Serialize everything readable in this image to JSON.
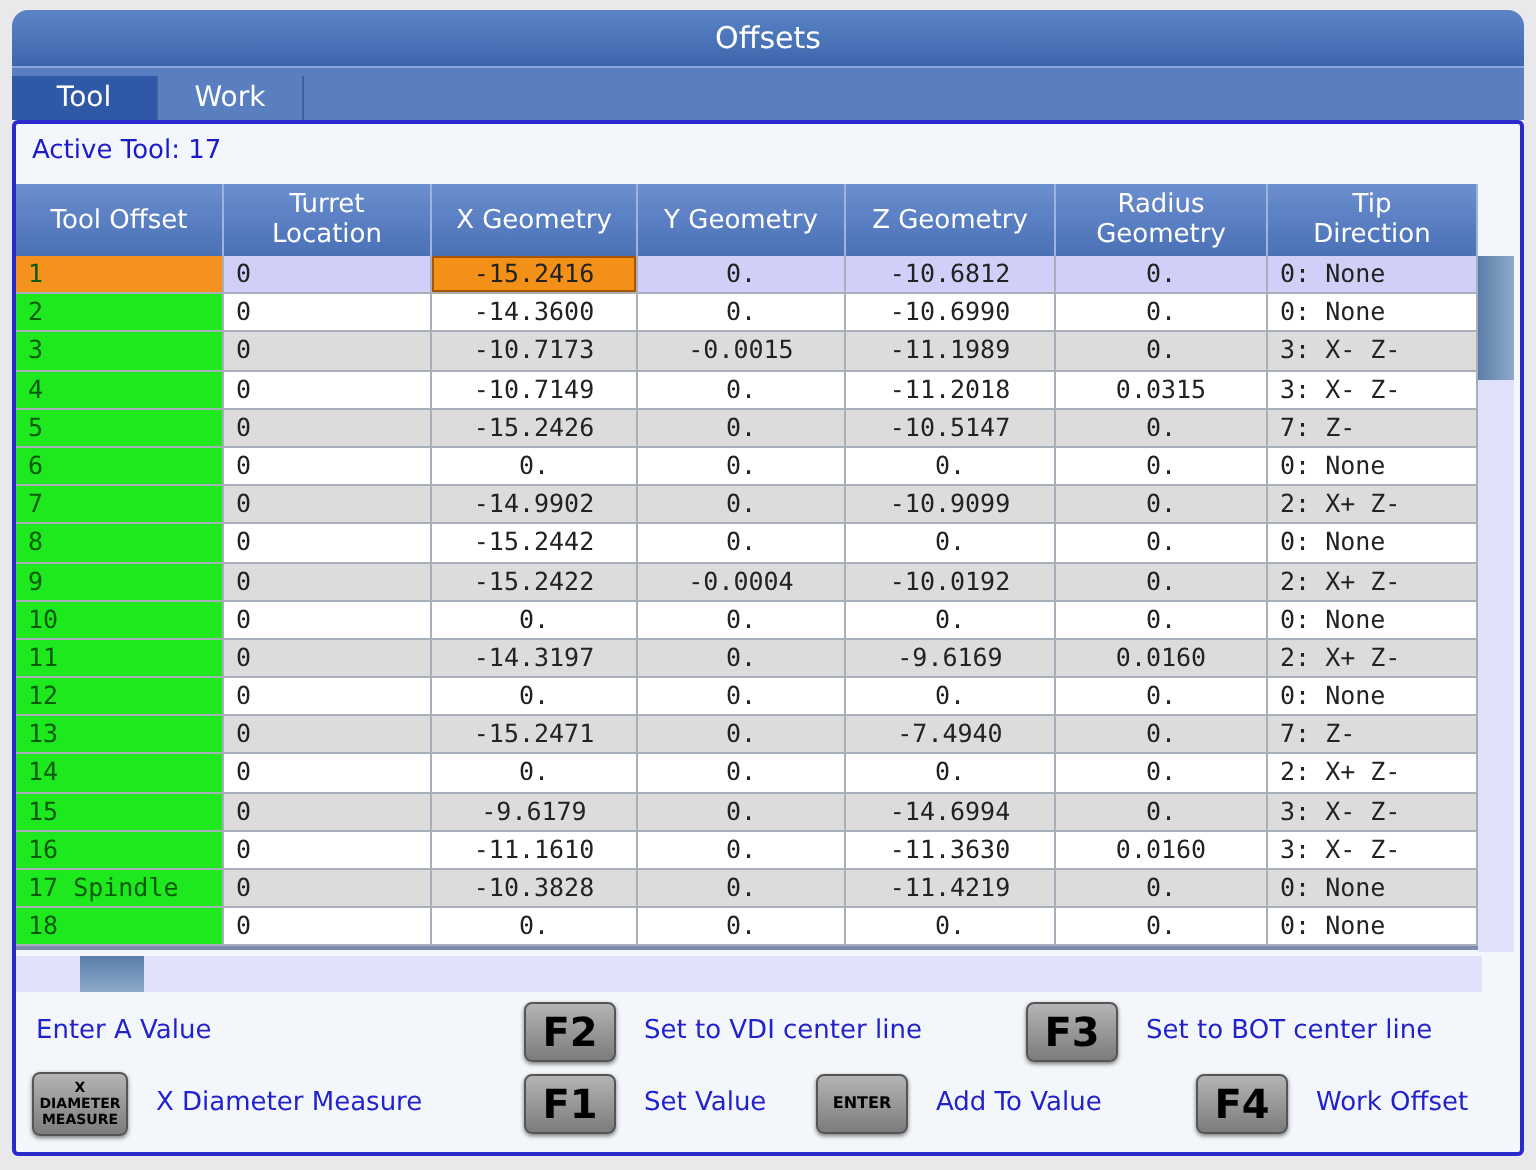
{
  "window": {
    "title": "Offsets"
  },
  "tabs": [
    {
      "label": "Tool",
      "selected": true
    },
    {
      "label": "Work",
      "selected": false
    }
  ],
  "active_tool": "Active Tool: 17",
  "table": {
    "columns": [
      "Tool Offset",
      "Turret Location",
      "X Geometry",
      "Y Geometry",
      "Z Geometry",
      "Radius Geometry",
      "Tip Direction"
    ],
    "rows": [
      {
        "selected": true,
        "cells": [
          {
            "text": "1",
            "cursor": false
          },
          {
            "text": "0",
            "cursor": false
          },
          {
            "text": "-15.2416",
            "cursor": true
          },
          {
            "text": "0.",
            "cursor": false
          },
          {
            "text": "-10.6812",
            "cursor": false
          },
          {
            "text": "0.",
            "cursor": false
          },
          {
            "text": "0: None",
            "cursor": false
          }
        ]
      },
      {
        "selected": false,
        "cells": [
          {
            "text": "2",
            "cursor": false
          },
          {
            "text": "0",
            "cursor": false
          },
          {
            "text": "-14.3600",
            "cursor": false
          },
          {
            "text": "0.",
            "cursor": false
          },
          {
            "text": "-10.6990",
            "cursor": false
          },
          {
            "text": "0.",
            "cursor": false
          },
          {
            "text": "0: None",
            "cursor": false
          }
        ]
      },
      {
        "selected": false,
        "cells": [
          {
            "text": "3",
            "cursor": false
          },
          {
            "text": "0",
            "cursor": false
          },
          {
            "text": "-10.7173",
            "cursor": false
          },
          {
            "text": "-0.0015",
            "cursor": false
          },
          {
            "text": "-11.1989",
            "cursor": false
          },
          {
            "text": "0.",
            "cursor": false
          },
          {
            "text": "3: X- Z-",
            "cursor": false
          }
        ]
      },
      {
        "selected": false,
        "cells": [
          {
            "text": "4",
            "cursor": false
          },
          {
            "text": "0",
            "cursor": false
          },
          {
            "text": "-10.7149",
            "cursor": false
          },
          {
            "text": "0.",
            "cursor": false
          },
          {
            "text": "-11.2018",
            "cursor": false
          },
          {
            "text": "0.0315",
            "cursor": false
          },
          {
            "text": "3: X- Z-",
            "cursor": false
          }
        ]
      },
      {
        "selected": false,
        "cells": [
          {
            "text": "5",
            "cursor": false
          },
          {
            "text": "0",
            "cursor": false
          },
          {
            "text": "-15.2426",
            "cursor": false
          },
          {
            "text": "0.",
            "cursor": false
          },
          {
            "text": "-10.5147",
            "cursor": false
          },
          {
            "text": "0.",
            "cursor": false
          },
          {
            "text": "7: Z-",
            "cursor": false
          }
        ]
      },
      {
        "selected": false,
        "cells": [
          {
            "text": "6",
            "cursor": false
          },
          {
            "text": "0",
            "cursor": false
          },
          {
            "text": "0.",
            "cursor": false
          },
          {
            "text": "0.",
            "cursor": false
          },
          {
            "text": "0.",
            "cursor": false
          },
          {
            "text": "0.",
            "cursor": false
          },
          {
            "text": "0: None",
            "cursor": false
          }
        ]
      },
      {
        "selected": false,
        "cells": [
          {
            "text": "7",
            "cursor": false
          },
          {
            "text": "0",
            "cursor": false
          },
          {
            "text": "-14.9902",
            "cursor": false
          },
          {
            "text": "0.",
            "cursor": false
          },
          {
            "text": "-10.9099",
            "cursor": false
          },
          {
            "text": "0.",
            "cursor": false
          },
          {
            "text": "2: X+ Z-",
            "cursor": false
          }
        ]
      },
      {
        "selected": false,
        "cells": [
          {
            "text": "8",
            "cursor": false
          },
          {
            "text": "0",
            "cursor": false
          },
          {
            "text": "-15.2442",
            "cursor": false
          },
          {
            "text": "0.",
            "cursor": false
          },
          {
            "text": "0.",
            "cursor": false
          },
          {
            "text": "0.",
            "cursor": false
          },
          {
            "text": "0: None",
            "cursor": false
          }
        ]
      },
      {
        "selected": false,
        "cells": [
          {
            "text": "9",
            "cursor": false
          },
          {
            "text": "0",
            "cursor": false
          },
          {
            "text": "-15.2422",
            "cursor": false
          },
          {
            "text": "-0.0004",
            "cursor": false
          },
          {
            "text": "-10.0192",
            "cursor": false
          },
          {
            "text": "0.",
            "cursor": false
          },
          {
            "text": "2: X+ Z-",
            "cursor": false
          }
        ]
      },
      {
        "selected": false,
        "cells": [
          {
            "text": "10",
            "cursor": false
          },
          {
            "text": "0",
            "cursor": false
          },
          {
            "text": "0.",
            "cursor": false
          },
          {
            "text": "0.",
            "cursor": false
          },
          {
            "text": "0.",
            "cursor": false
          },
          {
            "text": "0.",
            "cursor": false
          },
          {
            "text": "0: None",
            "cursor": false
          }
        ]
      },
      {
        "selected": false,
        "cells": [
          {
            "text": "11",
            "cursor": false
          },
          {
            "text": "0",
            "cursor": false
          },
          {
            "text": "-14.3197",
            "cursor": false
          },
          {
            "text": "0.",
            "cursor": false
          },
          {
            "text": "-9.6169",
            "cursor": false
          },
          {
            "text": "0.0160",
            "cursor": false
          },
          {
            "text": "2: X+ Z-",
            "cursor": false
          }
        ]
      },
      {
        "selected": false,
        "cells": [
          {
            "text": "12",
            "cursor": false
          },
          {
            "text": "0",
            "cursor": false
          },
          {
            "text": "0.",
            "cursor": false
          },
          {
            "text": "0.",
            "cursor": false
          },
          {
            "text": "0.",
            "cursor": false
          },
          {
            "text": "0.",
            "cursor": false
          },
          {
            "text": "0: None",
            "cursor": false
          }
        ]
      },
      {
        "selected": false,
        "cells": [
          {
            "text": "13",
            "cursor": false
          },
          {
            "text": "0",
            "cursor": false
          },
          {
            "text": "-15.2471",
            "cursor": false
          },
          {
            "text": "0.",
            "cursor": false
          },
          {
            "text": "-7.4940",
            "cursor": false
          },
          {
            "text": "0.",
            "cursor": false
          },
          {
            "text": "7: Z-",
            "cursor": false
          }
        ]
      },
      {
        "selected": false,
        "cells": [
          {
            "text": "14",
            "cursor": false
          },
          {
            "text": "0",
            "cursor": false
          },
          {
            "text": "0.",
            "cursor": false
          },
          {
            "text": "0.",
            "cursor": false
          },
          {
            "text": "0.",
            "cursor": false
          },
          {
            "text": "0.",
            "cursor": false
          },
          {
            "text": "2: X+ Z-",
            "cursor": false
          }
        ]
      },
      {
        "selected": false,
        "cells": [
          {
            "text": "15",
            "cursor": false
          },
          {
            "text": "0",
            "cursor": false
          },
          {
            "text": "-9.6179",
            "cursor": false
          },
          {
            "text": "0.",
            "cursor": false
          },
          {
            "text": "-14.6994",
            "cursor": false
          },
          {
            "text": "0.",
            "cursor": false
          },
          {
            "text": "3: X- Z-",
            "cursor": false
          }
        ]
      },
      {
        "selected": false,
        "cells": [
          {
            "text": "16",
            "cursor": false
          },
          {
            "text": "0",
            "cursor": false
          },
          {
            "text": "-11.1610",
            "cursor": false
          },
          {
            "text": "0.",
            "cursor": false
          },
          {
            "text": "-11.3630",
            "cursor": false
          },
          {
            "text": "0.0160",
            "cursor": false
          },
          {
            "text": "3: X- Z-",
            "cursor": false
          }
        ]
      },
      {
        "selected": false,
        "cells": [
          {
            "text": "17 Spindle",
            "cursor": false
          },
          {
            "text": "0",
            "cursor": false
          },
          {
            "text": "-10.3828",
            "cursor": false
          },
          {
            "text": "0.",
            "cursor": false
          },
          {
            "text": "-11.4219",
            "cursor": false
          },
          {
            "text": "0.",
            "cursor": false
          },
          {
            "text": "0: None",
            "cursor": false
          }
        ]
      },
      {
        "selected": false,
        "cells": [
          {
            "text": "18",
            "cursor": false
          },
          {
            "text": "0",
            "cursor": false
          },
          {
            "text": "0.",
            "cursor": false
          },
          {
            "text": "0.",
            "cursor": false
          },
          {
            "text": "0.",
            "cursor": false
          },
          {
            "text": "0.",
            "cursor": false
          },
          {
            "text": "0: None",
            "cursor": false
          }
        ]
      }
    ]
  },
  "hints": [
    [
      {
        "kind": "text",
        "text": "Enter A Value"
      },
      {
        "kind": "key",
        "key": "F2",
        "text": "Set to VDI center line"
      },
      {
        "kind": "key",
        "key": "F3",
        "text": "Set to BOT center line"
      }
    ],
    [
      {
        "kind": "wide_key",
        "key": "X DIAMETER MEASURE",
        "text": "X Diameter Measure"
      },
      {
        "kind": "key",
        "key": "F1",
        "text": "Set Value"
      },
      {
        "kind": "small_key",
        "key": "ENTER",
        "text": "Add To Value"
      },
      {
        "kind": "key",
        "key": "F4",
        "text": "Work Offset"
      }
    ]
  ]
}
